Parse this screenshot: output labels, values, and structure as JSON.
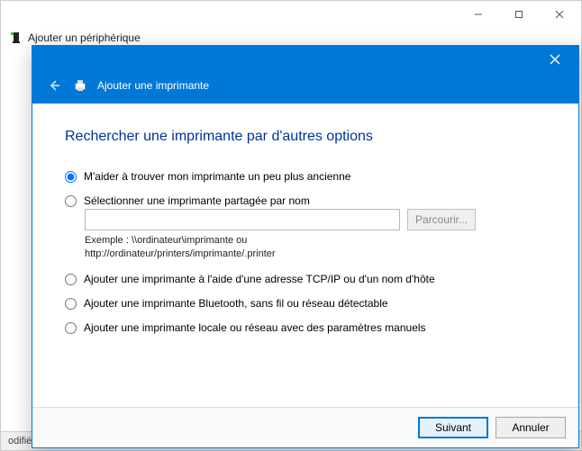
{
  "parent": {
    "title": "Ajouter un périphérique",
    "status_prefix": "odifiée"
  },
  "wizard": {
    "header_title": "Ajouter une imprimante",
    "heading": "Rechercher une imprimante par d'autres options",
    "options": {
      "legacy": "M'aider à trouver mon imprimante un peu plus ancienne",
      "shared": "Sélectionner une imprimante partagée par nom",
      "shared_value": "",
      "shared_placeholder": "",
      "browse": "Parcourir...",
      "example_line1": "Exemple : \\\\ordinateur\\imprimante ou",
      "example_line2": "http://ordinateur/printers/imprimante/.printer",
      "tcpip": "Ajouter une imprimante à l'aide d'une adresse TCP/IP ou d'un nom d'hôte",
      "bluetooth": "Ajouter une imprimante Bluetooth, sans fil ou réseau détectable",
      "local": "Ajouter une imprimante locale ou réseau avec des paramètres manuels"
    },
    "footer": {
      "next": "Suivant",
      "cancel": "Annuler"
    }
  }
}
